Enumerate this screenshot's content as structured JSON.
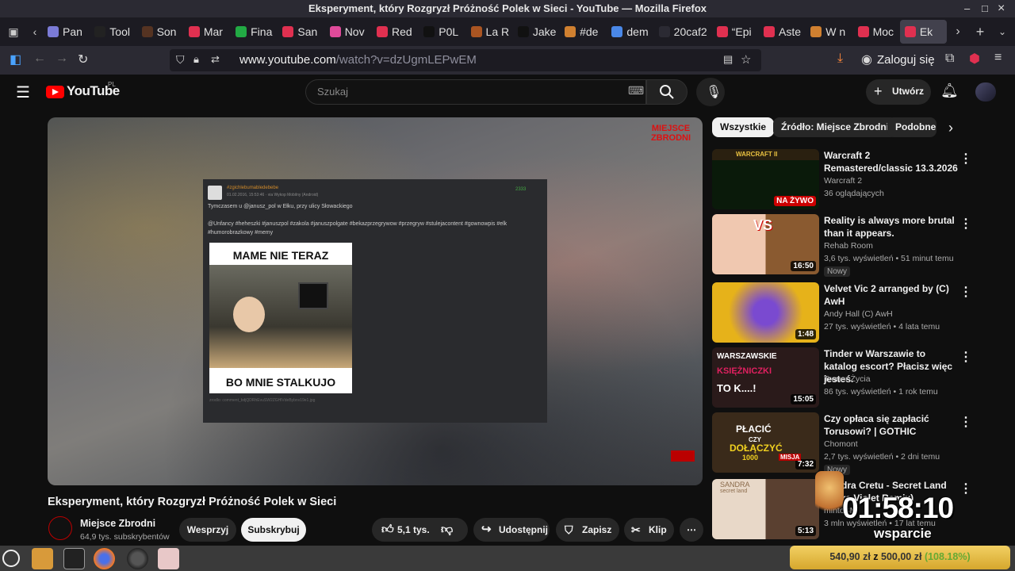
{
  "window": {
    "title": "Eksperyment, który Rozgryzł Próżność Polek w Sieci - YouTube — Mozilla Firefox",
    "min": "–",
    "max": "□",
    "close": "×"
  },
  "tabs": [
    {
      "label": "Pan",
      "color": "#7b7bd6"
    },
    {
      "label": "Tool",
      "color": "#222222"
    },
    {
      "label": "Son",
      "color": "#553322"
    },
    {
      "label": "Mar",
      "color": "#e03050"
    },
    {
      "label": "Fina",
      "color": "#22aa44"
    },
    {
      "label": "San",
      "color": "#e03050"
    },
    {
      "label": "Nov",
      "color": "#e04a9a"
    },
    {
      "label": "Red",
      "color": "#e03050"
    },
    {
      "label": "P0L",
      "color": "#111111"
    },
    {
      "label": "La R",
      "color": "#aa5522"
    },
    {
      "label": "Jake",
      "color": "#111111"
    },
    {
      "label": "#de",
      "color": "#d08030"
    },
    {
      "label": "dem",
      "color": "#4a88e8"
    },
    {
      "label": "20caf2",
      "color": "#2b2a33"
    },
    {
      "label": "“Epi",
      "color": "#e03050"
    },
    {
      "label": "Aste",
      "color": "#e03050"
    },
    {
      "label": "W n",
      "color": "#d08030"
    },
    {
      "label": "Moc",
      "color": "#e03050"
    },
    {
      "label": "Ek",
      "color": "#e03050"
    }
  ],
  "navbar": {
    "url_host": "www.youtube.com",
    "url_path": "/watch?v=dzUgmLEPwEM",
    "login": "Zaloguj się"
  },
  "yt": {
    "logo": "YouTube",
    "region": "PL",
    "search_placeholder": "Szukaj",
    "create": "Utwórz",
    "chips": [
      "Wszystkie",
      "Źródło: Miejsce Zbrodni",
      "Podobne"
    ]
  },
  "player": {
    "channel_watermark": "MIEJSCE ZBRODNI",
    "post_user": "#zgichlebumabledebebe",
    "post_meta": "01.02.2016, 15:53:46 · via Wykop Mobilny (Android)",
    "post_score": "2333",
    "post_text": "Tymczasem u @janusz_pol w Ełku, przy ulicy Słowackiego",
    "post_tags": "@Unfancy #heheszki #januszpol #zakola #januszpolgate #bekazprzegrywow #przegryw #stulejacontent #gownowpis #elk #humorobrazkowy #memy",
    "meme_top": "MAME NIE TERAZ",
    "meme_bottom": "BO MNIE STALKUJO",
    "post_footer": "zrodlo: comment_bdjQDRhEvuSW2ZGHlVdeBybnv19e1.jpg"
  },
  "video": {
    "title": "Eksperyment, który Rozgryzł Próżność Polek w Sieci",
    "channel": "Miejsce Zbrodni",
    "subs": "64,9 tys. subskrybentów",
    "support": "Wesprzyj",
    "subscribe": "Subskrybuj",
    "likes": "5,1 tys.",
    "share": "Udostępnij",
    "save": "Zapisz",
    "clip": "Klip"
  },
  "recs": [
    {
      "title": "Warcraft 2 Remastered/classic 13.3.2026",
      "channel": "Warcraft 2",
      "meta": "36 oglądających",
      "badge": "NA ŻYWO",
      "thumb": "#1a2a1a",
      "new": ""
    },
    {
      "title": "Reality is always more brutal than it appears.",
      "channel": "Rehab Room",
      "meta": "3,6 tys. wyświetleń • 51 minut temu",
      "badge": "16:50",
      "thumb": "#c2203a",
      "new": "Nowy"
    },
    {
      "title": "Velvet Vic 2 arranged by (C) AwH",
      "channel": "Andy Hall (C) AwH",
      "meta": "27 tys. wyświetleń • 4 lata temu",
      "badge": "1:48",
      "thumb": "#e6b21a",
      "new": ""
    },
    {
      "title": "Tinder w Warszawie to katalog escort? Płacisz więc jesteś.",
      "channel": "Trener Życia",
      "meta": "86 tys. wyświetleń • 1 rok temu",
      "badge": "15:05",
      "thumb": "#2a1a1a",
      "new": ""
    },
    {
      "title": "Czy opłaca się zapłacić Torusowi? | GOTHIC",
      "channel": "Chomont",
      "meta": "2,7 tys. wyświetleń • 2 dni temu",
      "badge": "7:32",
      "thumb": "#3a2a1a",
      "new": "Nowy"
    },
    {
      "title": "Sandra Cretu - Secret Land (Extra Violet Remix)",
      "channel": "mintoSM",
      "meta": "3 mln wyświetleń • 17 lat temu",
      "badge": "5:13",
      "thumb": "#e8d8c8",
      "new": ""
    }
  ],
  "overlay": {
    "clock": "01:58:10",
    "label": "wsparcie",
    "progress_text_a": "540,90 zł",
    "progress_text_mid": "z",
    "progress_text_b": "500,00 zł",
    "progress_text_pct": "(108.18%)",
    "progress_fraction": 1.0818
  },
  "thumb_labels": {
    "vs": "VS",
    "warszawskie": "WARSZAWSKIE",
    "ksiezniczki": "KSIĘŻNICZKI",
    "tok": "TO K....!",
    "placic": "PŁACIĆ",
    "czy": "CZY",
    "dolaczyc": "DOŁĄCZYĆ",
    "misja": "MISJA",
    "kwota": "1000",
    "sandra": "SANDRA",
    "secret": "secret land",
    "warcraft": "WARCRAFT II"
  }
}
